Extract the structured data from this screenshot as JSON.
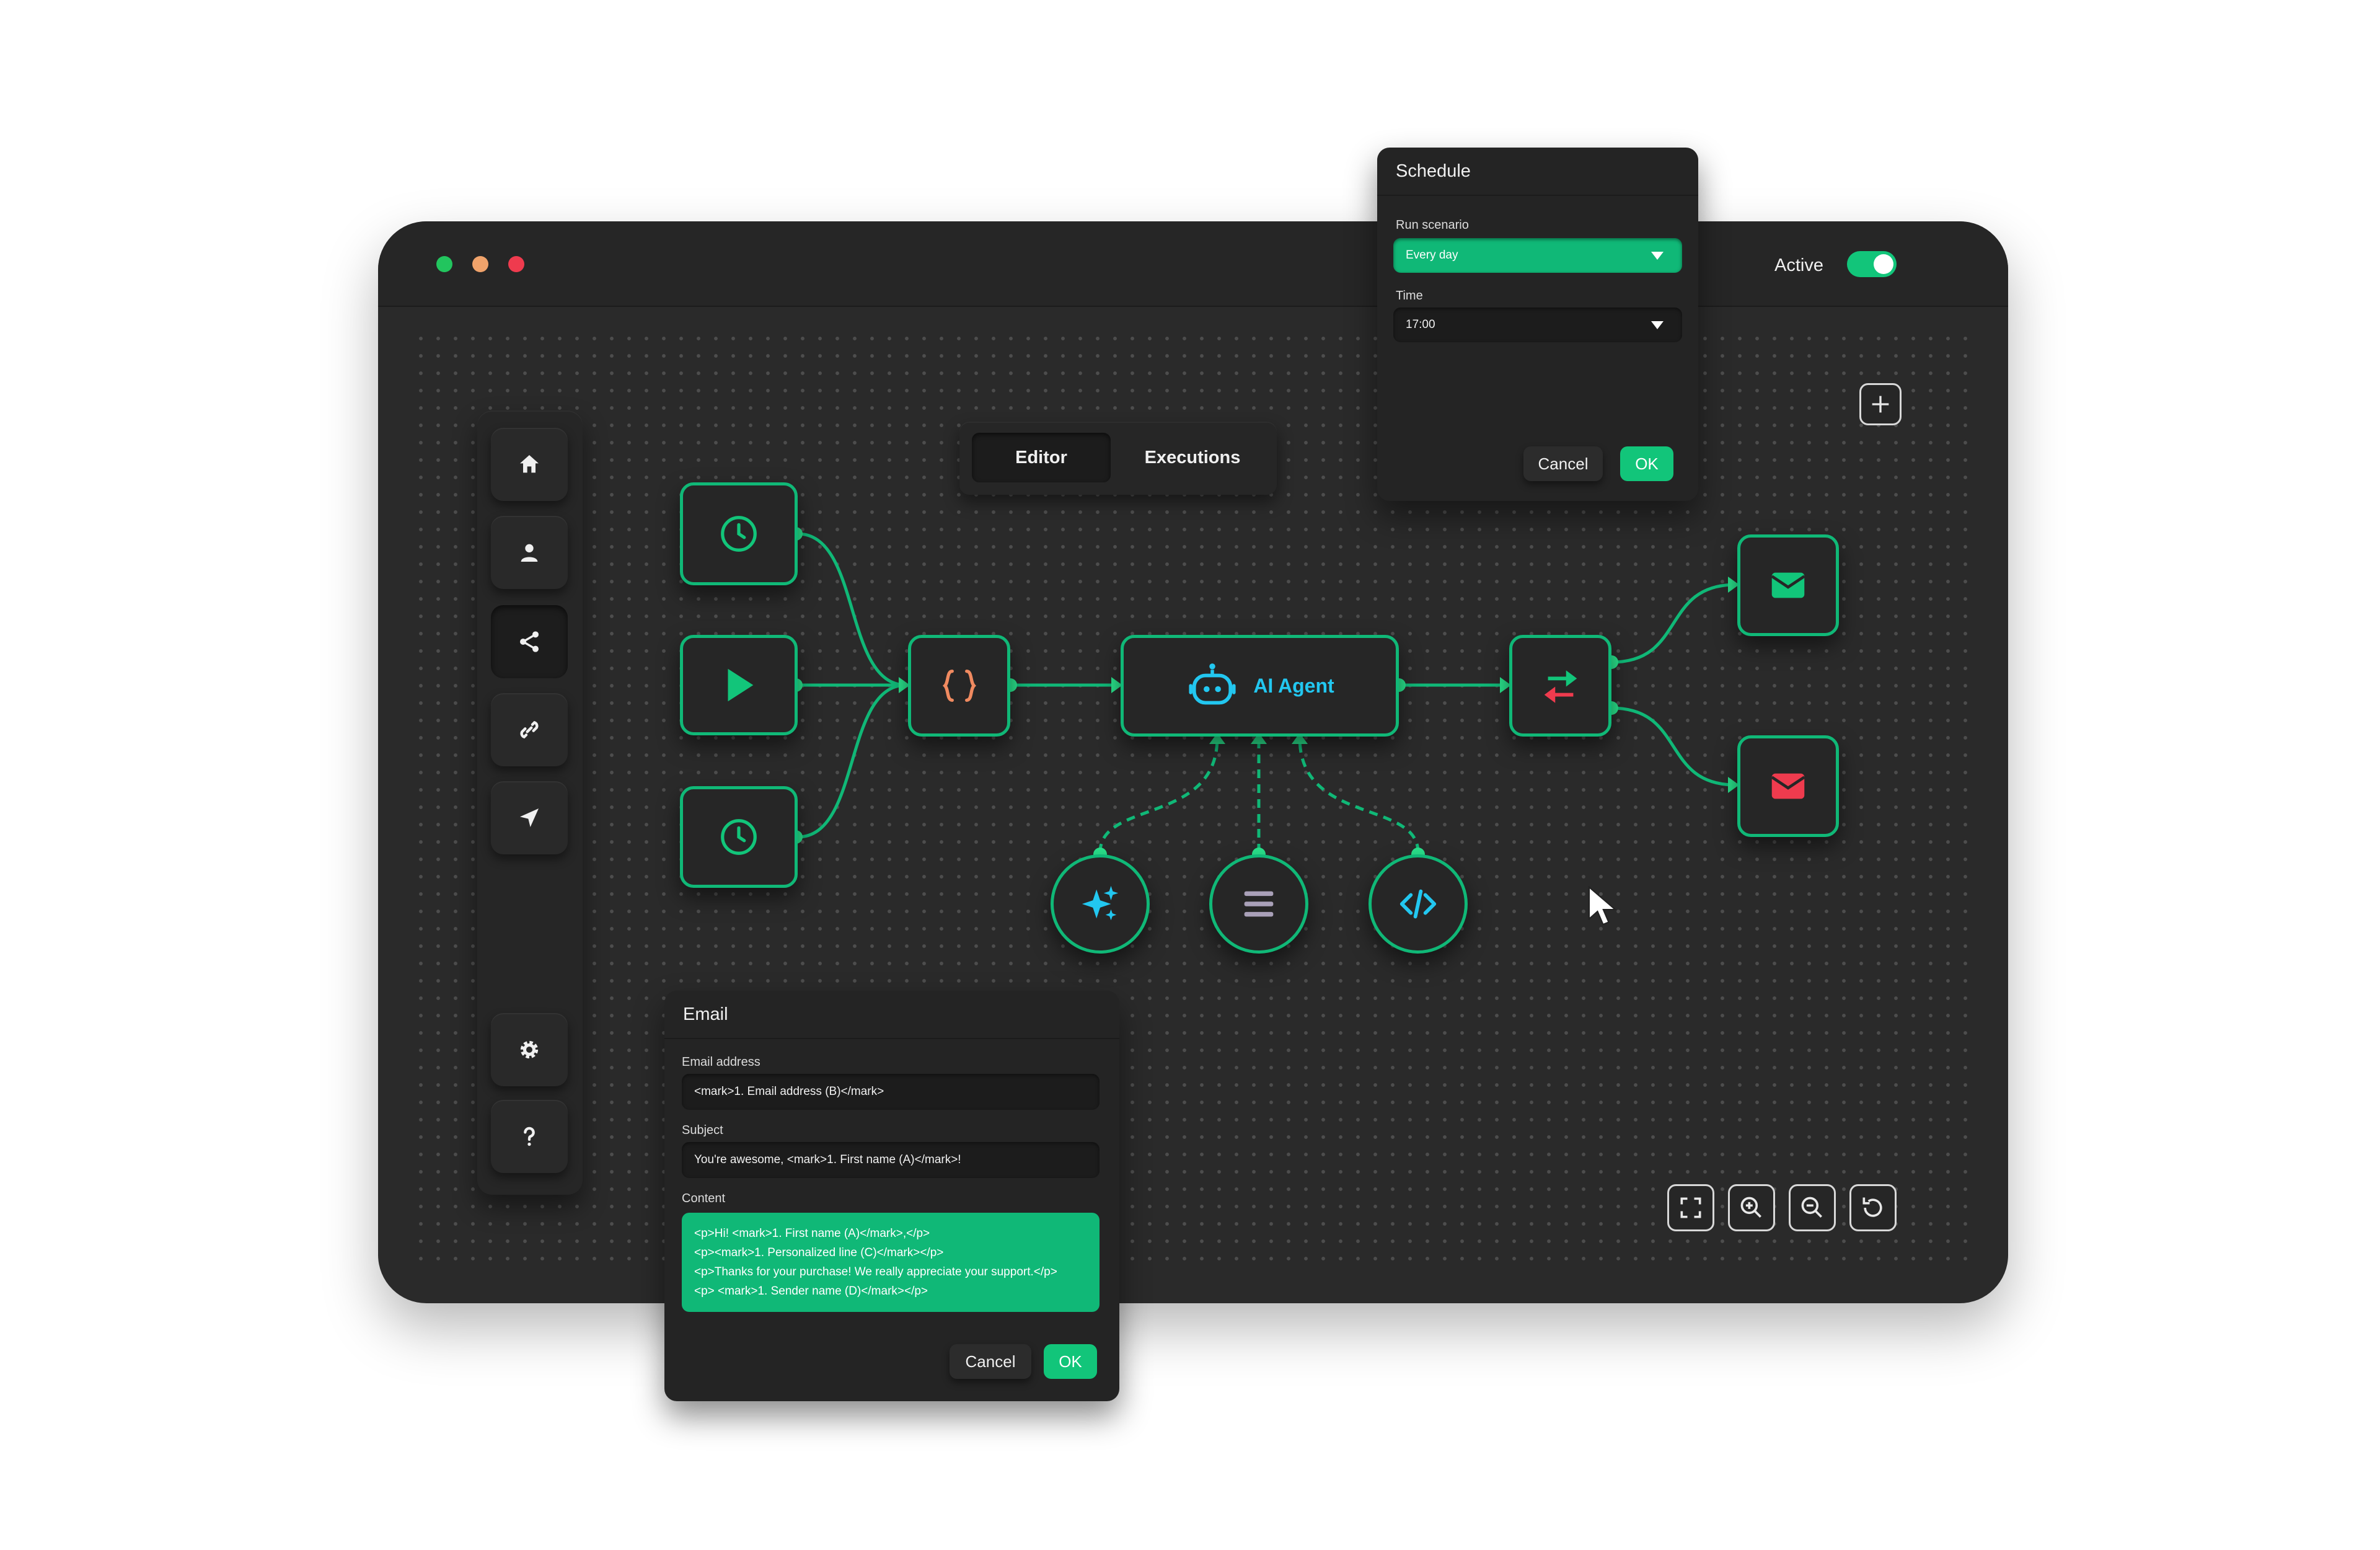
{
  "window": {
    "controls": [
      {
        "name": "window-dot-green",
        "color": "#22c55e"
      },
      {
        "name": "window-dot-orange",
        "color": "#f0a36b"
      },
      {
        "name": "window-dot-red",
        "color": "#ef3b4e"
      }
    ],
    "active_label": "Active",
    "active_toggle_on": true
  },
  "sidebar": {
    "items": [
      {
        "icon": "home-icon",
        "selected": false
      },
      {
        "icon": "user-icon",
        "selected": false
      },
      {
        "icon": "share-icon",
        "selected": true
      },
      {
        "icon": "link-icon",
        "selected": false
      },
      {
        "icon": "send-icon",
        "selected": false
      },
      {
        "icon": "gear-icon",
        "selected": false
      },
      {
        "icon": "help-icon",
        "selected": false
      }
    ]
  },
  "tabs": [
    {
      "label": "Editor",
      "selected": true
    },
    {
      "label": "Executions",
      "selected": false
    }
  ],
  "workflow": {
    "nodes": [
      {
        "icon": "clock-icon"
      },
      {
        "icon": "play-icon"
      },
      {
        "icon": "clock-icon"
      },
      {
        "icon": "code-braces-icon"
      },
      {
        "icon": "robot-icon",
        "label": "AI Agent"
      },
      {
        "icon": "swap-arrows-icon"
      },
      {
        "icon": "envelope-icon",
        "color": "#12c57a"
      },
      {
        "icon": "envelope-icon",
        "color": "#ef3b4e"
      }
    ],
    "subnodes": [
      {
        "icon": "sparkles-icon"
      },
      {
        "icon": "menu-lines-icon"
      },
      {
        "icon": "code-tag-icon"
      }
    ]
  },
  "schedule": {
    "title": "Schedule",
    "run_label": "Run scenario",
    "run_value": "Every day",
    "time_label": "Time",
    "time_value": "17:00",
    "cancel": "Cancel",
    "ok": "OK"
  },
  "email": {
    "title": "Email",
    "address_label": "Email address",
    "address_value": "<mark>1. Email address (B)</mark>",
    "subject_label": "Subject",
    "subject_value": "You're awesome, <mark>1. First name (A)</mark>!",
    "content_label": "Content",
    "content_lines": [
      "<p>Hi! <mark>1. First name (A)</mark>,</p>",
      "<p><mark>1. Personalized line (C)</mark></p>",
      "<p>Thanks for your purchase! We really appreciate your support.</p>",
      "<p>  <mark>1. Sender name (D)</mark></p>"
    ],
    "cancel": "Cancel",
    "ok": "OK"
  },
  "toolbar": [
    "fit-screen-icon",
    "zoom-in-icon",
    "zoom-out-icon",
    "reset-icon"
  ],
  "colors": {
    "accent": "#10b877",
    "agent_text": "#22c7f0",
    "window_bg": "#2a2a2a",
    "cursor": "#ffffff"
  }
}
